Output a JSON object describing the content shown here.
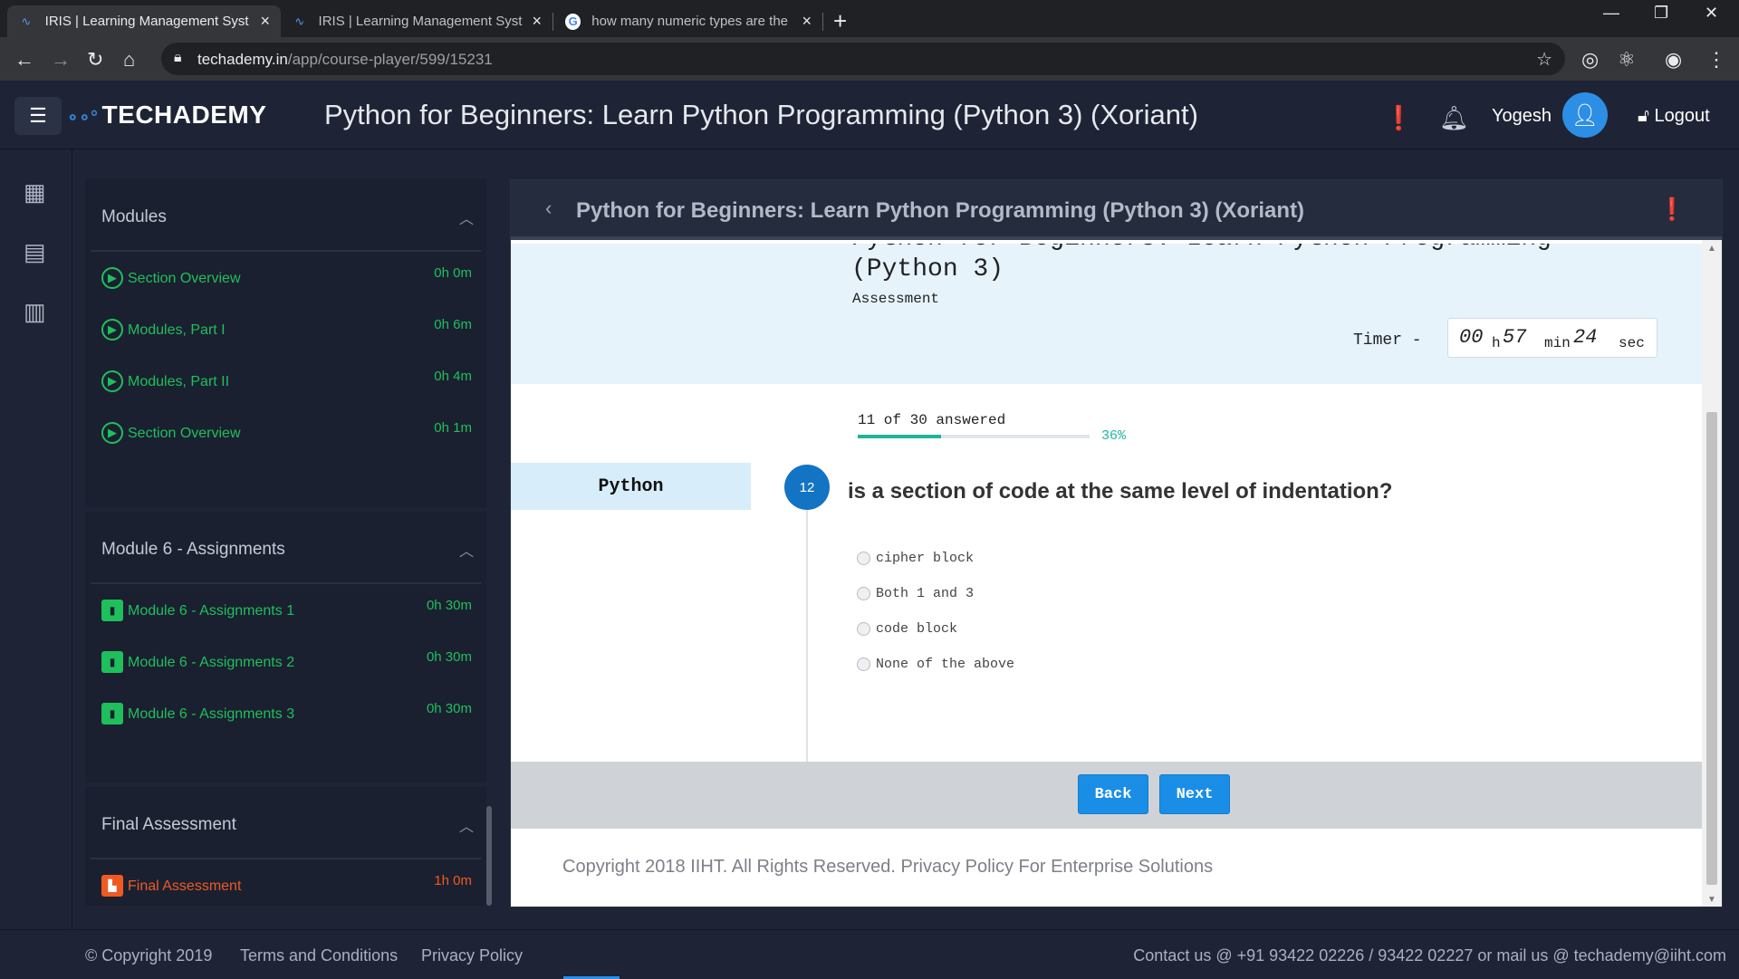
{
  "browser": {
    "tabs": [
      {
        "title": "IRIS | Learning Management Syst",
        "active": true
      },
      {
        "title": "IRIS | Learning Management Syst",
        "active": false
      },
      {
        "title": "how many numeric types are the",
        "active": false
      }
    ],
    "url_host": "techademy.in",
    "url_path": "/app/course-player/599/15231"
  },
  "header": {
    "logo": "TECHADEMY",
    "title": "Python for Beginners: Learn Python Programming (Python 3) (Xoriant)",
    "username": "Yogesh",
    "logout": "Logout"
  },
  "modules": [
    {
      "title": "Modules",
      "items": [
        {
          "title": "Section Overview",
          "duration": "0h 0m",
          "icon": "play"
        },
        {
          "title": "Modules, Part I",
          "duration": "0h 6m",
          "icon": "play"
        },
        {
          "title": "Modules, Part II",
          "duration": "0h 4m",
          "icon": "play"
        },
        {
          "title": "Section Overview",
          "duration": "0h 1m",
          "icon": "play"
        }
      ]
    },
    {
      "title": "Module 6 - Assignments",
      "items": [
        {
          "title": "Module 6 - Assignments 1",
          "duration": "0h 30m",
          "icon": "book"
        },
        {
          "title": "Module 6 - Assignments 2",
          "duration": "0h 30m",
          "icon": "book"
        },
        {
          "title": "Module 6 - Assignments 3",
          "duration": "0h 30m",
          "icon": "book"
        }
      ]
    },
    {
      "title": "Final Assessment",
      "items": [
        {
          "title": "Final Assessment",
          "duration": "1h 0m",
          "icon": "chart"
        }
      ]
    }
  ],
  "player": {
    "header_title": "Python for Beginners: Learn Python Programming (Python 3) (Xoriant)",
    "course_name": "Python for Beginners: Learn Python Programming (Python 3)",
    "assessment_label": "Assessment",
    "timer_label": "Timer -",
    "timer": {
      "hours": "00",
      "h_unit": "h",
      "minutes": "57",
      "m_unit": "min",
      "seconds": "24",
      "s_unit": "sec"
    },
    "progress_text": "11 of 30 answered",
    "progress_fraction": 0.36,
    "progress_pct": "36%",
    "category": "Python",
    "question_number": "12",
    "question": "is a section of code at the same level of indentation?",
    "options": [
      "cipher block",
      "Both 1 and 3",
      "code block",
      "None of the above"
    ],
    "back_label": "Back",
    "next_label": "Next",
    "copyright": "Copyright 2018 IIHT. All Rights Reserved. Privacy Policy For Enterprise Solutions"
  },
  "footer": {
    "copyright": "© Copyright 2019",
    "terms": "Terms and Conditions",
    "privacy": "Privacy Policy",
    "contact": "Contact us @ +91 93422 02226 / 93422 02227 or mail us @ techademy@iiht.com"
  }
}
